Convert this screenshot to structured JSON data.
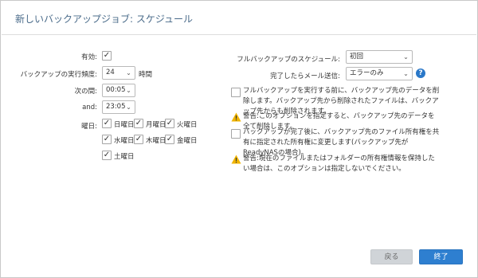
{
  "dialog": {
    "title": "新しいバックアップジョブ: スケジュール"
  },
  "left": {
    "enabled_label": "有効:",
    "frequency_label": "バックアップの実行頻度:",
    "frequency_value": "24",
    "frequency_unit": "時間",
    "between_label": "次の間:",
    "between_value": "00:05",
    "and_label": "and:",
    "and_value": "23:05",
    "days_label": "曜日:",
    "days": [
      "日曜日",
      "月曜日",
      "火曜日",
      "水曜日",
      "木曜日",
      "金曜日",
      "土曜日"
    ]
  },
  "right": {
    "full_backup_label": "フルバックアップのスケジュール:",
    "full_backup_value": "初回",
    "email_label": "完了したらメール送信:",
    "email_value": "エラーのみ",
    "option1_text": "フルバックアップを実行する前に、バックアップ先のデータを削除します。バックアップ先から削除されたファイルは、バックアップ先からも削除されます。",
    "warning1_text": "警告:このオプションを指定すると、バックアップ先のデータを全て削除します。",
    "option2_text": "バックアップが完了後に、バックアップ先のファイル所有権を共有に指定された所有権に変更します(バックアップ先がReadyNASの場合)。",
    "warning2_text": "警告:現在のファイルまたはフォルダーの所有権情報を保持したい場合は、このオプションは指定しないでください。"
  },
  "footer": {
    "back_label": "戻る",
    "finish_label": "終了"
  },
  "glyphs": {
    "check": "✓",
    "arrow": "⌄",
    "help": "?"
  },
  "colors": {
    "accent": "#2e7fd0",
    "warning": "#f0b400",
    "title": "#4a6b8a"
  }
}
